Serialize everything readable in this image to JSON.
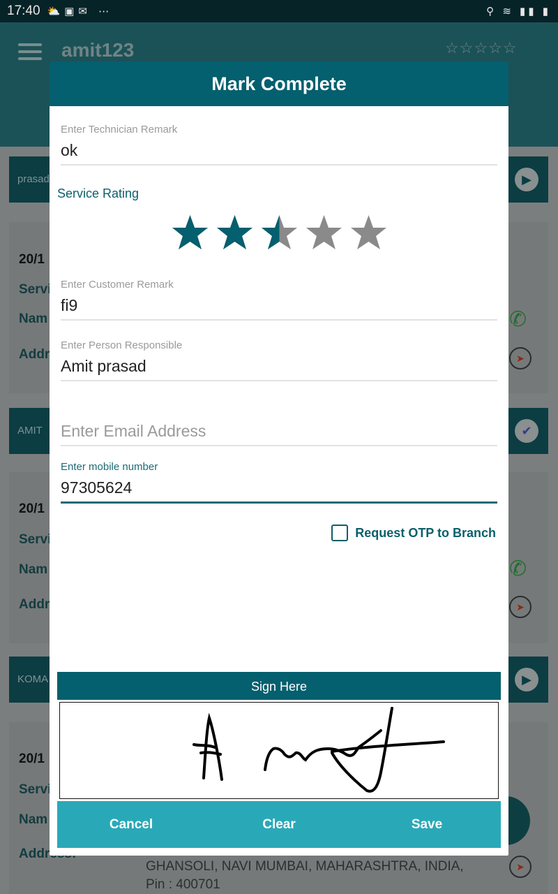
{
  "status_bar": {
    "time": "17:40",
    "left_icons": [
      "weather-icon",
      "contacts-icon",
      "gmail-icon",
      "more-icon"
    ],
    "right_icons": [
      "location-icon",
      "wifi-icon",
      "signal-icon",
      "battery-charging-icon"
    ]
  },
  "app_bar": {
    "username": "amit123",
    "rating_stars": "☆☆☆☆☆"
  },
  "background": {
    "cards": [
      {
        "header": "prasad",
        "icon": "play-icon"
      },
      {
        "header": "AMIT",
        "icon": "check-icon"
      },
      {
        "header": "KOMA",
        "icon": "play-icon"
      }
    ],
    "labels": {
      "date": "20/1",
      "service": "Servi",
      "name": "Nam",
      "address": "Addr",
      "address_full": "Address:"
    },
    "address_text": "GHANSOLI, NAVI MUMBAI, MAHARASHTRA, INDIA, Pin : 400701"
  },
  "dialog": {
    "title": "Mark Complete",
    "technician_remark": {
      "label": "Enter Technician Remark",
      "value": "ok"
    },
    "service_rating": {
      "label": "Service Rating",
      "value": 2.5,
      "max": 5,
      "filled_color": "#045f6e",
      "empty_color": "#8a8a8a"
    },
    "customer_remark": {
      "label": "Enter Customer Remark",
      "value": "fi9"
    },
    "person_responsible": {
      "label": "Enter Person Responsible",
      "value": "Amit prasad"
    },
    "email": {
      "placeholder": "Enter Email Address",
      "value": ""
    },
    "mobile": {
      "label": "Enter mobile number",
      "value": "97305624"
    },
    "otp_checkbox": {
      "label": "Request OTP to Branch",
      "checked": false
    },
    "sign_header": "Sign Here",
    "buttons": {
      "cancel": "Cancel",
      "clear": "Clear",
      "save": "Save"
    }
  },
  "colors": {
    "primary": "#045f6e",
    "button_bar": "#29a9b8"
  }
}
